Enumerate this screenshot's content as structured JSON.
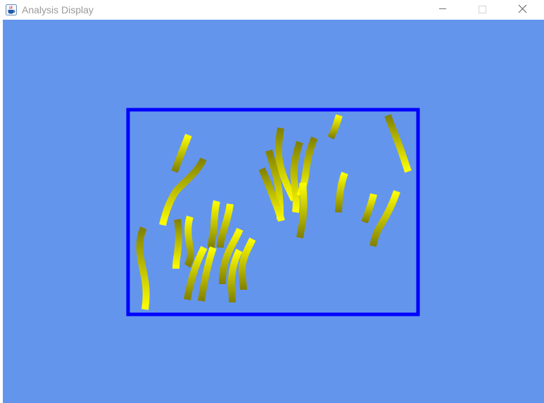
{
  "window": {
    "title": "Analysis Display",
    "app_icon": "java-coffee-cup-icon",
    "controls": [
      "minimize-icon",
      "maximize-icon",
      "close-icon"
    ]
  },
  "display": {
    "background_color": "#6495ed",
    "frame_color": "#0000ff",
    "worm_colors": [
      "#ffff00",
      "#808000"
    ],
    "object_count": 26
  }
}
